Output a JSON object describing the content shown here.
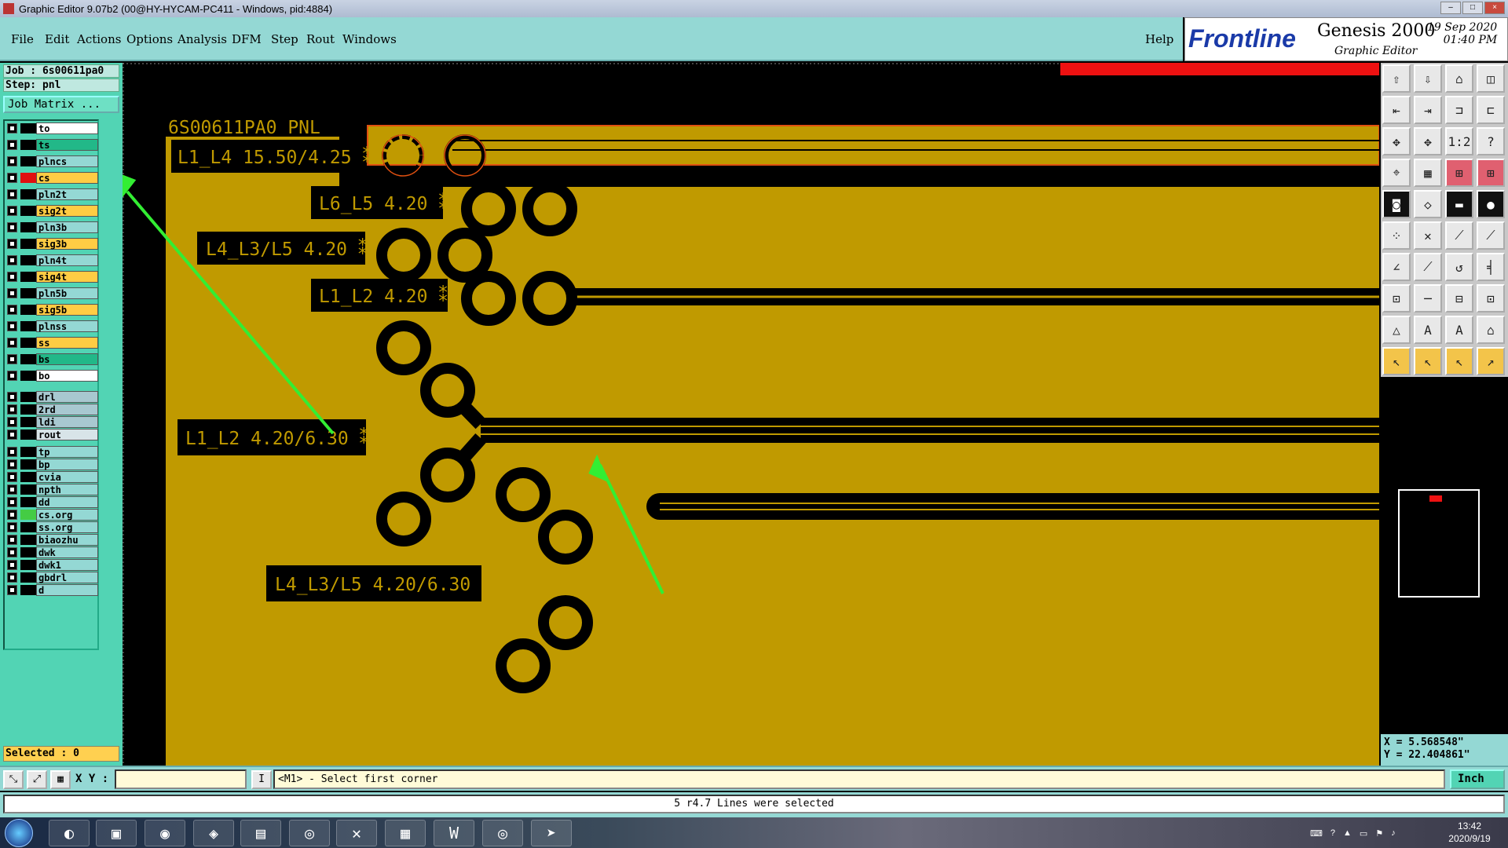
{
  "window": {
    "title": "Graphic Editor 9.07b2 (00@HY-HYCAM-PC411 - Windows, pid:4884)"
  },
  "menu": {
    "items": [
      "File",
      "Edit",
      "Actions",
      "Options",
      "Analysis",
      "DFM",
      "Step",
      "Rout",
      "Windows"
    ],
    "help": "Help"
  },
  "brand": {
    "logo": "Frontline",
    "product": "Genesis 2000",
    "subtitle": "Graphic Editor",
    "date": "19 Sep 2020",
    "time": "01:40 PM"
  },
  "job": {
    "job_label": "Job : 6s00611pa0",
    "step_label": "Step: pnl",
    "matrix_button": "Job Matrix ..."
  },
  "layers": [
    {
      "name": "to",
      "color": "#ffffff",
      "swatch": "#000000"
    },
    {
      "name": "ts",
      "color": "#22b888",
      "swatch": "#000000"
    },
    {
      "name": "plncs",
      "color": "#94d8d4",
      "swatch": "#000000"
    },
    {
      "name": "cs",
      "color": "#ffcc44",
      "swatch": "#e01010"
    },
    {
      "name": "pln2t",
      "color": "#94d8d4",
      "swatch": "#000000"
    },
    {
      "name": "sig2t",
      "color": "#ffcc44",
      "swatch": "#000000"
    },
    {
      "name": "pln3b",
      "color": "#94d8d4",
      "swatch": "#000000"
    },
    {
      "name": "sig3b",
      "color": "#ffcc44",
      "swatch": "#000000"
    },
    {
      "name": "pln4t",
      "color": "#94d8d4",
      "swatch": "#000000"
    },
    {
      "name": "sig4t",
      "color": "#ffcc44",
      "swatch": "#000000"
    },
    {
      "name": "pln5b",
      "color": "#94d8d4",
      "swatch": "#000000"
    },
    {
      "name": "sig5b",
      "color": "#ffcc44",
      "swatch": "#000000"
    },
    {
      "name": "plnss",
      "color": "#94d8d4",
      "swatch": "#000000"
    },
    {
      "name": "ss",
      "color": "#ffcc44",
      "swatch": "#000000"
    },
    {
      "name": "bs",
      "color": "#22b888",
      "swatch": "#000000"
    },
    {
      "name": "bo",
      "color": "#ffffff",
      "swatch": "#000000"
    },
    {
      "name": "drl",
      "color": "#a8c8d0",
      "swatch": "#000000"
    },
    {
      "name": "2rd",
      "color": "#a8c8d0",
      "swatch": "#000000"
    },
    {
      "name": "ldi",
      "color": "#a8c8d0",
      "swatch": "#000000"
    },
    {
      "name": "rout",
      "color": "#d8e4e8",
      "swatch": "#000000"
    },
    {
      "name": "tp",
      "color": "#94d8d4",
      "swatch": "#000000"
    },
    {
      "name": "bp",
      "color": "#94d8d4",
      "swatch": "#000000"
    },
    {
      "name": "cvia",
      "color": "#94d8d4",
      "swatch": "#000000"
    },
    {
      "name": "npth",
      "color": "#94d8d4",
      "swatch": "#000000"
    },
    {
      "name": "dd",
      "color": "#94d8d4",
      "swatch": "#000000"
    },
    {
      "name": "cs.org",
      "color": "#94d8d4",
      "swatch": "#44cc44"
    },
    {
      "name": "ss.org",
      "color": "#94d8d4",
      "swatch": "#000000"
    },
    {
      "name": "biaozhu",
      "color": "#94d8d4",
      "swatch": "#000000"
    },
    {
      "name": "dwk",
      "color": "#94d8d4",
      "swatch": "#000000"
    },
    {
      "name": "dwk1",
      "color": "#94d8d4",
      "swatch": "#000000"
    },
    {
      "name": "gbdrl",
      "color": "#94d8d4",
      "swatch": "#000000"
    },
    {
      "name": "d",
      "color": "#94d8d4",
      "swatch": "#000000"
    }
  ],
  "selected": "Selected : 0",
  "canvas_labels": [
    "6S00611PA0 PNL",
    "L1_L4 15.50/4.25 ⁑",
    "L6_L5 4.20 ⁑",
    "L4_L3/L5 4.20 ⁑",
    "L1_L2 4.20 ⁑",
    "L1_L2 4.20/6.30 ⁑",
    "L4_L3/L5 4.20/6.30 ⁑"
  ],
  "coords": {
    "x": "X = 5.568548\"",
    "y": "Y = 22.404861\""
  },
  "status": {
    "xy_label": "X Y :",
    "xy_value": "",
    "prompt": "<M1> - Select first corner",
    "unit": "Inch",
    "message": "5 r4.7 Lines were selected"
  },
  "taskbar": {
    "time": "13:42",
    "date": "2020/9/19"
  },
  "colors": {
    "copper": "#c09a00",
    "annotation_arrow": "#33ee33",
    "highlight": "#ee1111"
  }
}
